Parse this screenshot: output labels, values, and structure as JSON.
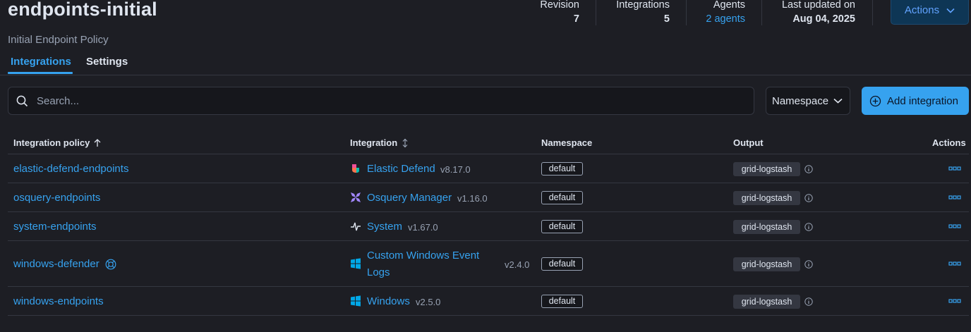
{
  "header": {
    "title": "endpoints-initial",
    "subtitle": "Initial Endpoint Policy",
    "stats": {
      "revision_label": "Revision",
      "revision_value": "7",
      "integrations_label": "Integrations",
      "integrations_value": "5",
      "agents_label": "Agents",
      "agents_value": "2 agents",
      "updated_label": "Last updated on",
      "updated_value": "Aug 04, 2025"
    },
    "actions_label": "Actions"
  },
  "tabs": {
    "integrations": "Integrations",
    "settings": "Settings"
  },
  "toolbar": {
    "search_placeholder": "Search...",
    "namespace_label": "Namespace",
    "add_label": "Add integration"
  },
  "table": {
    "columns": {
      "policy": "Integration policy",
      "integration": "Integration",
      "namespace": "Namespace",
      "output": "Output",
      "actions": "Actions"
    },
    "rows": [
      {
        "policy": "elastic-defend-endpoints",
        "integration": "Elastic Defend",
        "version": "v8.17.0",
        "namespace": "default",
        "output": "grid-logstash",
        "icon": "elastic-defend-icon"
      },
      {
        "policy": "osquery-endpoints",
        "integration": "Osquery Manager",
        "version": "v1.16.0",
        "namespace": "default",
        "output": "grid-logstash",
        "icon": "osquery-icon"
      },
      {
        "policy": "system-endpoints",
        "integration": "System",
        "version": "v1.67.0",
        "namespace": "default",
        "output": "grid-logstash",
        "icon": "system-icon"
      },
      {
        "policy": "windows-defender",
        "integration_line1": "Custom Windows Event",
        "integration_line2": "Logs",
        "version": "v2.4.0",
        "namespace": "default",
        "output": "grid-logstash",
        "icon": "windows-icon",
        "policy_badge_icon": "shared-policy-icon"
      },
      {
        "policy": "windows-endpoints",
        "integration": "Windows",
        "version": "v2.5.0",
        "namespace": "default",
        "output": "grid-logstash",
        "icon": "windows-icon"
      }
    ]
  },
  "colors": {
    "accent": "#36a2ef",
    "background": "#1d1e24",
    "primary_button": "#36a2ef"
  }
}
